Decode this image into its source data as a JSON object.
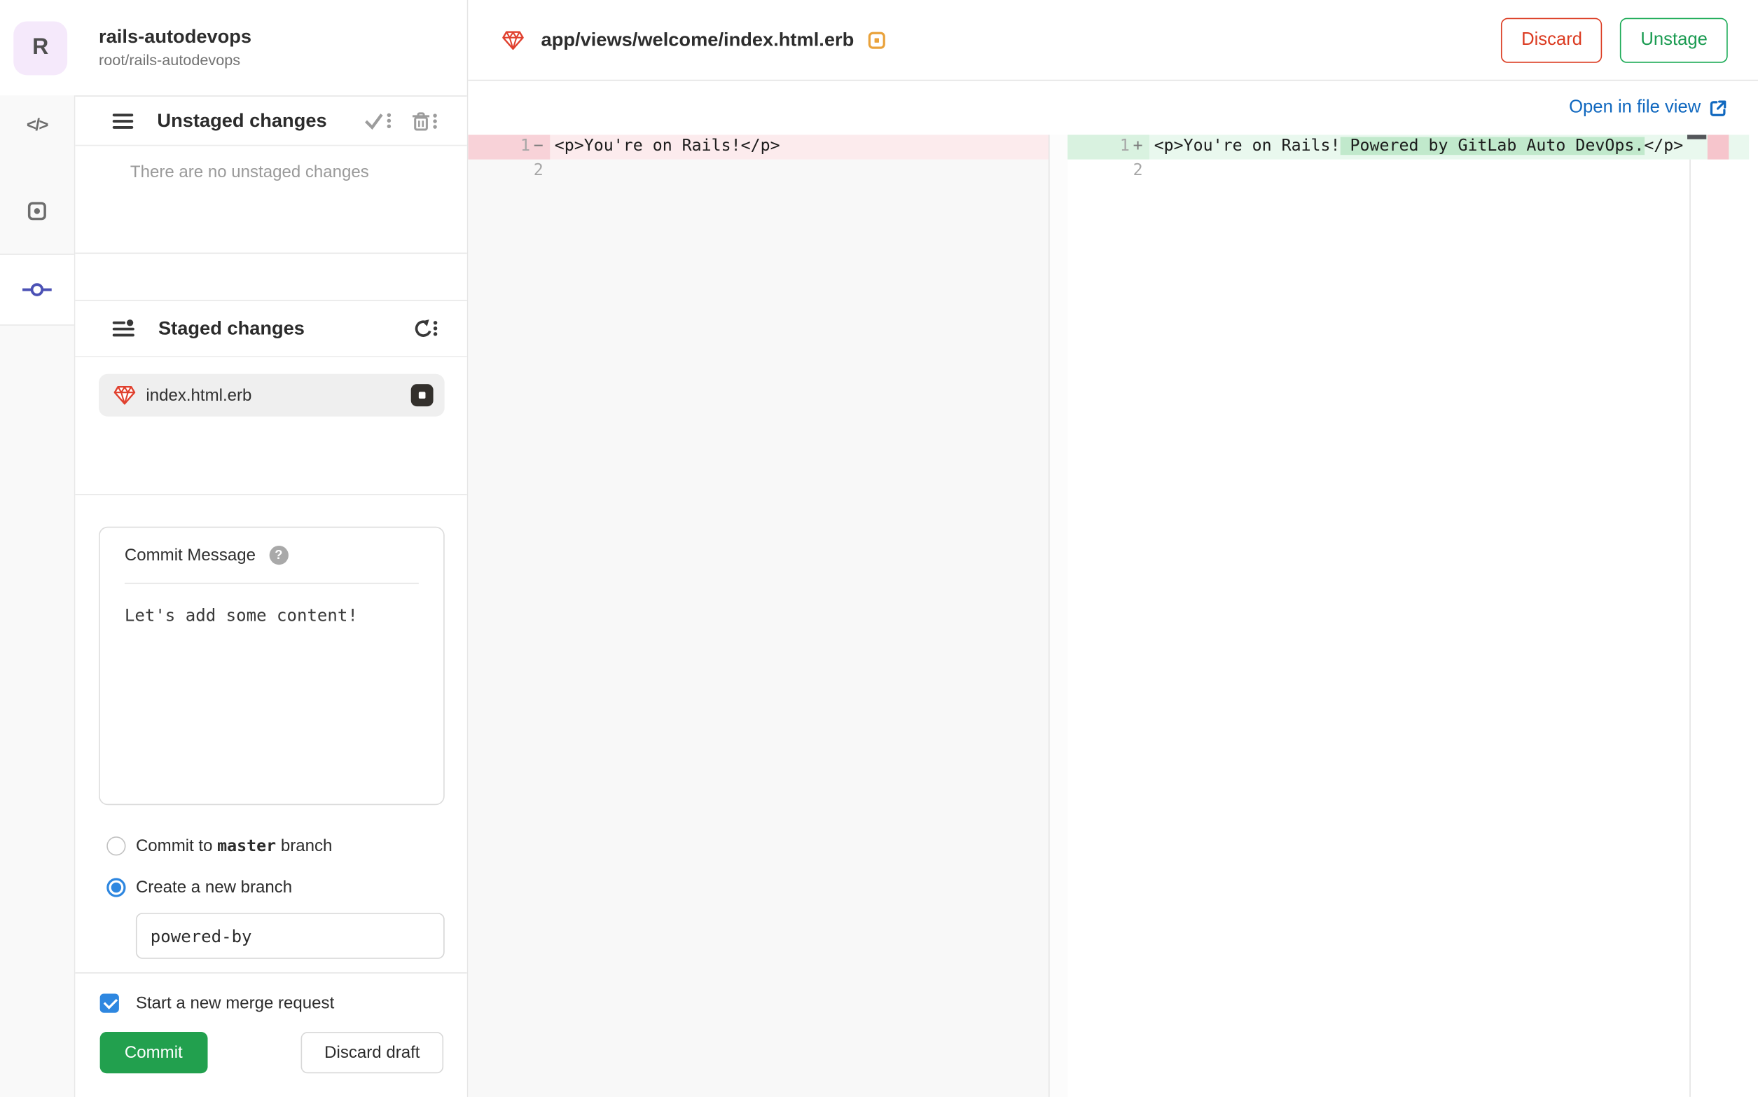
{
  "project": {
    "avatar_letter": "R",
    "name": "rails-autodevops",
    "path": "root/rails-autodevops"
  },
  "panel": {
    "unstaged": {
      "title": "Unstaged changes",
      "empty_text": "There are no unstaged changes"
    },
    "staged": {
      "title": "Staged changes",
      "file_name": "index.html.erb"
    },
    "commit": {
      "message_label": "Commit Message",
      "help_glyph": "?",
      "message_value": "Let's add some content!",
      "radio_master_pre": "Commit to ",
      "radio_master_branch": "master",
      "radio_master_post": " branch",
      "radio_new_branch_label": "Create a new branch",
      "branch_input_value": "powered-by",
      "merge_request_label": "Start a new merge request",
      "commit_button_label": "Commit",
      "discard_draft_label": "Discard draft"
    }
  },
  "diff_header": {
    "file_path": "app/views/welcome/index.html.erb",
    "discard_label": "Discard",
    "unstage_label": "Unstage"
  },
  "file_view_link": {
    "label": "Open in file view"
  },
  "diff": {
    "left": {
      "line1_number": "1",
      "line1_sign": "−",
      "line1_code": "<p>You're on Rails!</p>",
      "line2_number": "2"
    },
    "right": {
      "line1_number": "1",
      "line1_sign": "+",
      "line1_code_pre": "<p>You're on Rails!",
      "line1_code_added": " Powered by GitLab Auto DevOps.",
      "line1_code_post": "</p>",
      "line2_number": "2"
    }
  },
  "colors": {
    "link_blue": "#1068bf",
    "control_blue": "#2e87e0",
    "commit_green": "#22a04e",
    "discard_red": "#db3b21",
    "unstage_green": "#1aaa55",
    "ruby_red": "#e0402e",
    "modified_orange": "#e9a23b",
    "diff_removed_row": "#fcebed",
    "diff_removed_gutter": "#f8d2d8",
    "diff_added_row": "#e9f8ee",
    "diff_added_gutter": "#d9f2e0",
    "diff_added_highlight": "#c1e9cc"
  }
}
